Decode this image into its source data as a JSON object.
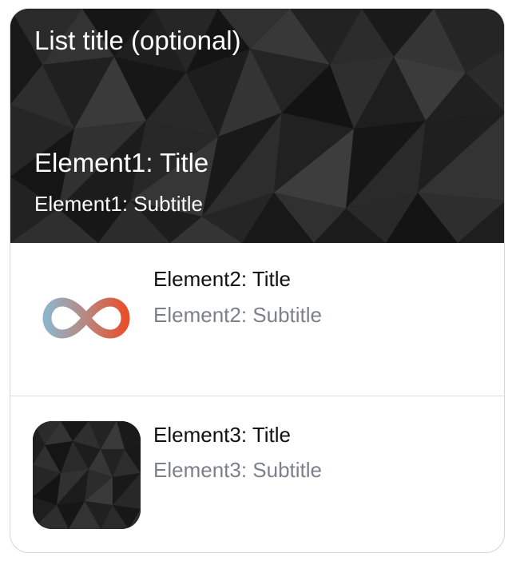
{
  "list": {
    "title": "List title (optional)",
    "elements": [
      {
        "title": "Element1: Title",
        "subtitle": "Element1: Subtitle",
        "image": "dark-polygon-texture"
      },
      {
        "title": "Element2: Title",
        "subtitle": "Element2: Subtitle",
        "image": "infinity-logo"
      },
      {
        "title": "Element3: Title",
        "subtitle": "Element3: Subtitle",
        "image": "dark-polygon-texture"
      }
    ]
  },
  "colors": {
    "title_text": "#111111",
    "subtitle_text": "#7b808a",
    "divider": "#dedede",
    "logo_gradient_start": "#7fa8c0",
    "logo_gradient_end": "#e8502c"
  }
}
